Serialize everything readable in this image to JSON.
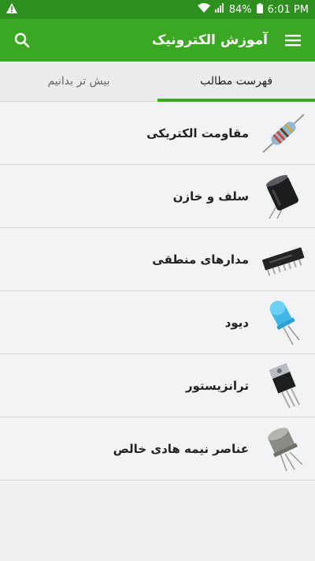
{
  "status": {
    "battery": "84%",
    "time": "6:01 PM",
    "warning_icon": "warning-icon",
    "wifi_icon": "wifi-icon",
    "signal_icon": "signal-icon",
    "battery_icon": "battery-icon"
  },
  "toolbar": {
    "title": "آموزش الکترونیک",
    "search_icon": "search-icon",
    "menu_icon": "menu-icon",
    "color": "#3aa822"
  },
  "tabs": [
    {
      "label": "بیش تر بدانیم"
    },
    {
      "label": "فهرست مطالب"
    }
  ],
  "items": [
    {
      "label": "مقاومت الکتریکی",
      "icon": "resistor-icon"
    },
    {
      "label": "سلف و خازن",
      "icon": "capacitor-icon"
    },
    {
      "label": "مدارهای منطقی",
      "icon": "ic-chip-icon"
    },
    {
      "label": "دیود",
      "icon": "led-icon"
    },
    {
      "label": "ترانزیستور",
      "icon": "transistor-icon"
    },
    {
      "label": "عناصر نیمه هادی خالص",
      "icon": "metal-transistor-icon"
    }
  ]
}
